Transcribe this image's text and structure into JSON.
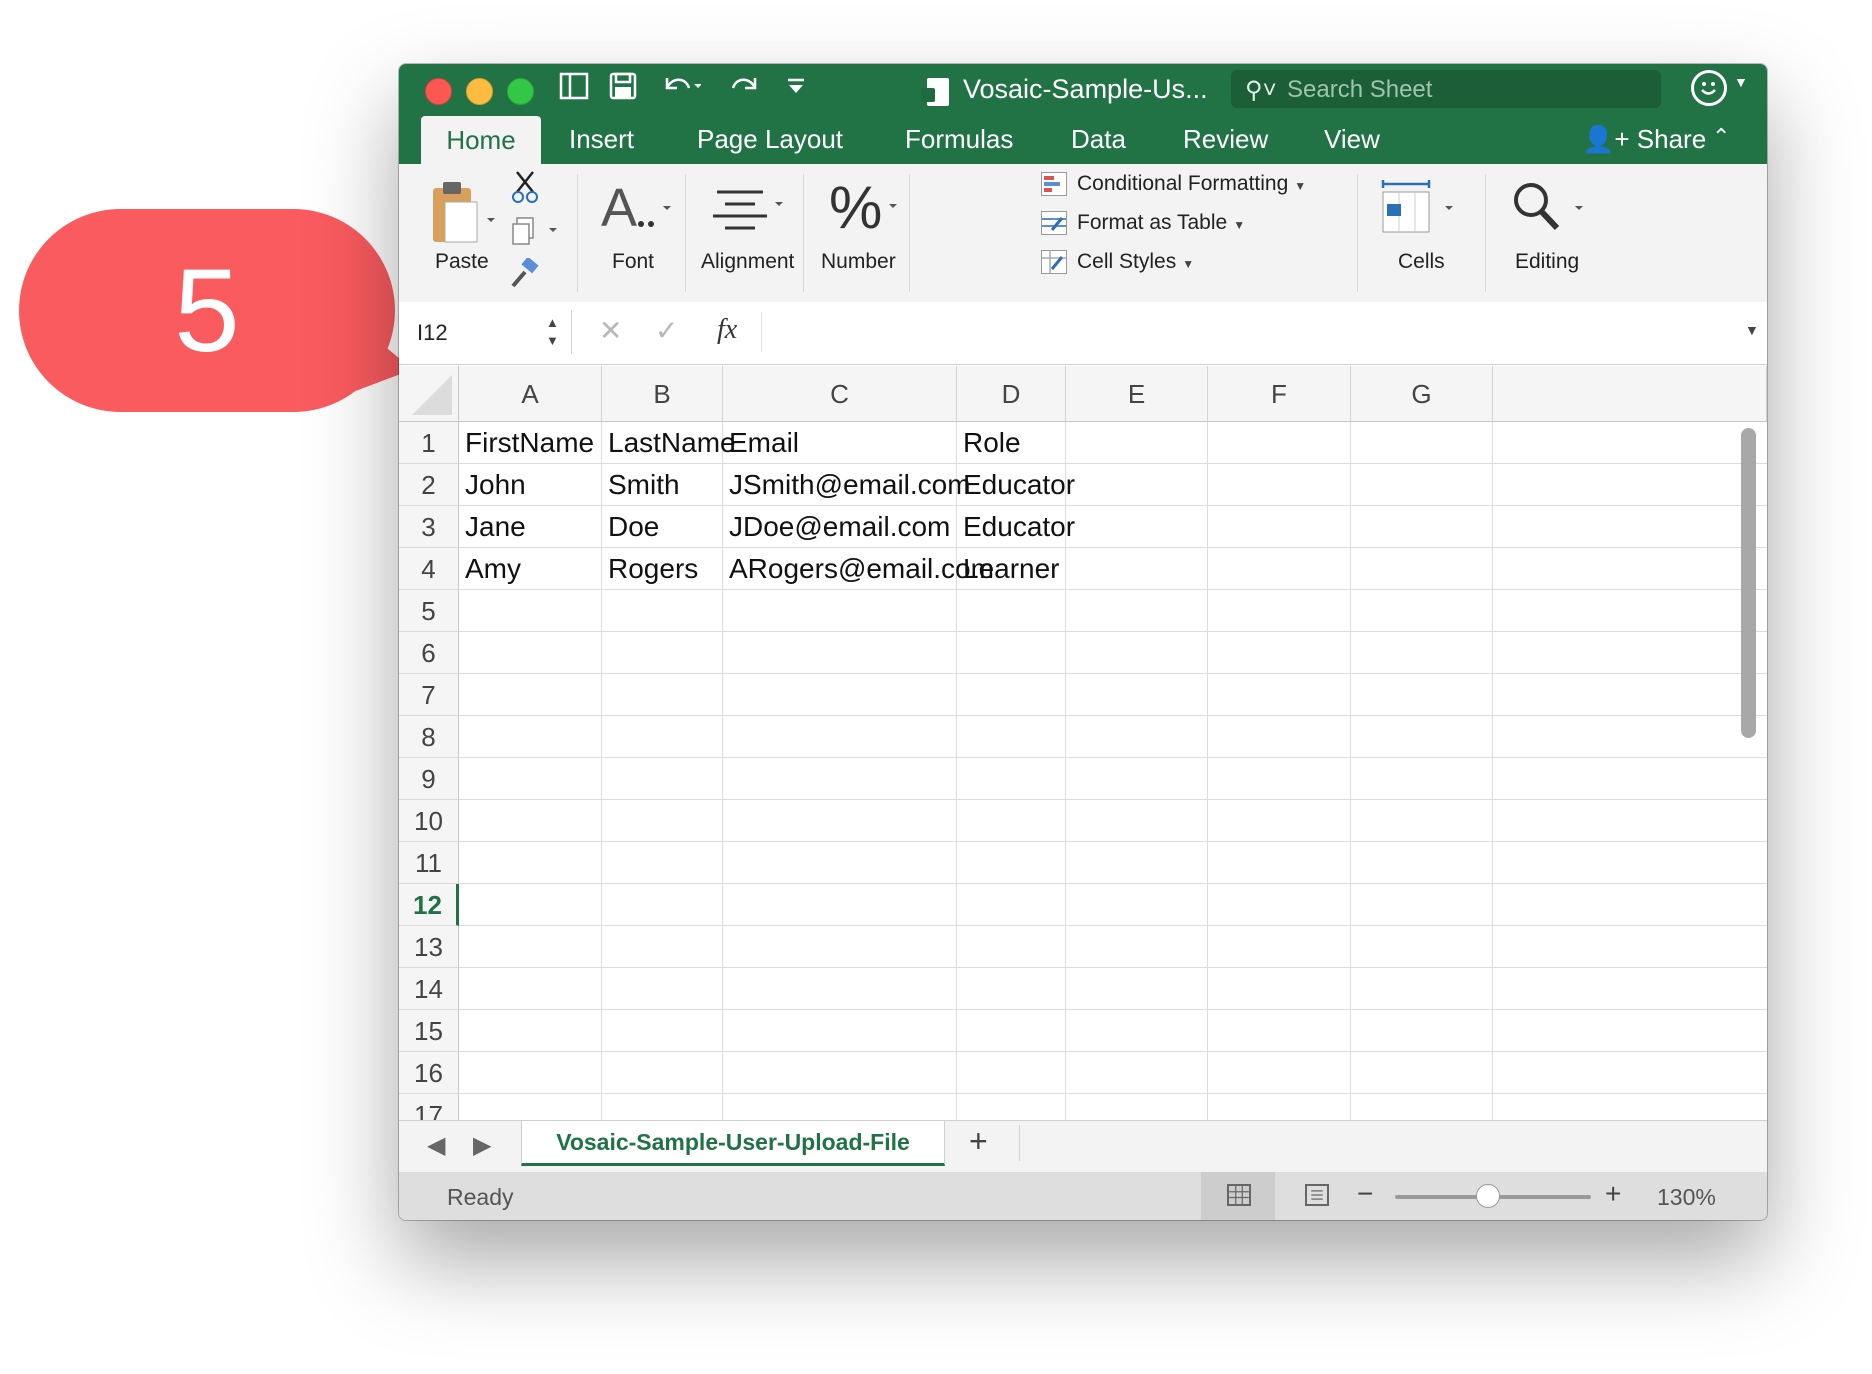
{
  "callout": {
    "number": "5"
  },
  "window": {
    "title": "Vosaic-Sample-Us...",
    "search_placeholder": "Search Sheet"
  },
  "ribbon_tabs": [
    "Home",
    "Insert",
    "Page Layout",
    "Formulas",
    "Data",
    "Review",
    "View"
  ],
  "share_label": "Share",
  "ribbon": {
    "paste": "Paste",
    "font": "Font",
    "alignment": "Alignment",
    "number": "Number",
    "conditional_formatting": "Conditional Formatting",
    "format_as_table": "Format as Table",
    "cell_styles": "Cell Styles",
    "cells": "Cells",
    "editing": "Editing"
  },
  "formula_bar": {
    "name_box": "I12",
    "fx": "fx",
    "content": ""
  },
  "grid": {
    "columns": [
      "A",
      "B",
      "C",
      "D",
      "E",
      "F",
      "G"
    ],
    "rows": [
      "1",
      "2",
      "3",
      "4",
      "5",
      "6",
      "7",
      "8",
      "9",
      "10",
      "11",
      "12",
      "13",
      "14",
      "15",
      "16",
      "17"
    ],
    "selected_row": "12",
    "data": [
      [
        "FirstName",
        "LastName",
        "Email",
        "Role"
      ],
      [
        "John",
        "Smith",
        "JSmith@email.com",
        "Educator"
      ],
      [
        "Jane",
        "Doe",
        "JDoe@email.com",
        "Educator"
      ],
      [
        "Amy",
        "Rogers",
        "ARogers@email.com",
        "Learner"
      ]
    ]
  },
  "sheet_tab": "Vosaic-Sample-User-Upload-File",
  "status": {
    "ready": "Ready",
    "zoom": "130%"
  },
  "colors": {
    "excel_green": "#217346",
    "callout_red": "#fa5b5f"
  }
}
